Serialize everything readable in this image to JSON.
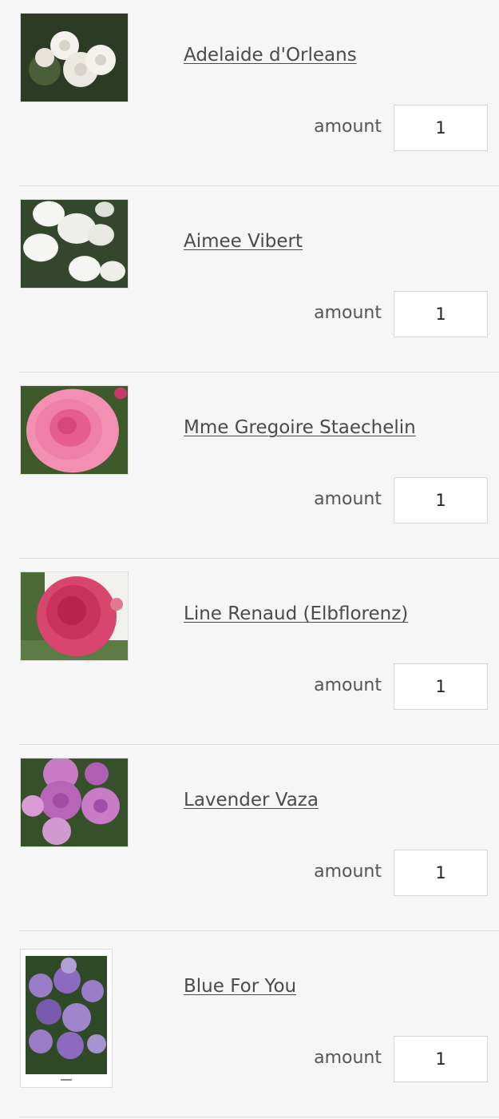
{
  "amount_label": "amount",
  "items": [
    {
      "name": "Adelaide d'Orleans",
      "quantity": "1",
      "image": "white-rose-cluster-photo",
      "colors": [
        "#f4f2ee",
        "#e7e3db",
        "#2c3b23"
      ]
    },
    {
      "name": "Aimee Vibert",
      "quantity": "1",
      "image": "white-rose-bush-photo",
      "colors": [
        "#f5f5f3",
        "#dedfd9",
        "#34472c"
      ]
    },
    {
      "name": "Mme Gregoire Staechelin",
      "quantity": "1",
      "image": "pink-rose-photo",
      "colors": [
        "#f28fb2",
        "#e55d8d",
        "#3e5a2a"
      ]
    },
    {
      "name": "Line Renaud (Elbflorenz)",
      "quantity": "1",
      "image": "deep-pink-rose-photo",
      "colors": [
        "#d8466f",
        "#b82350",
        "#4b6a36"
      ]
    },
    {
      "name": "Lavender Vaza",
      "quantity": "1",
      "image": "lavender-rose-cluster-photo",
      "colors": [
        "#c77cc5",
        "#a24ea6",
        "#36502a"
      ]
    },
    {
      "name": "Blue For You",
      "quantity": "1",
      "image": "blue-purple-rose-cluster-photo",
      "colors": [
        "#9a7cc8",
        "#7a5aae",
        "#2f4a26"
      ]
    }
  ]
}
